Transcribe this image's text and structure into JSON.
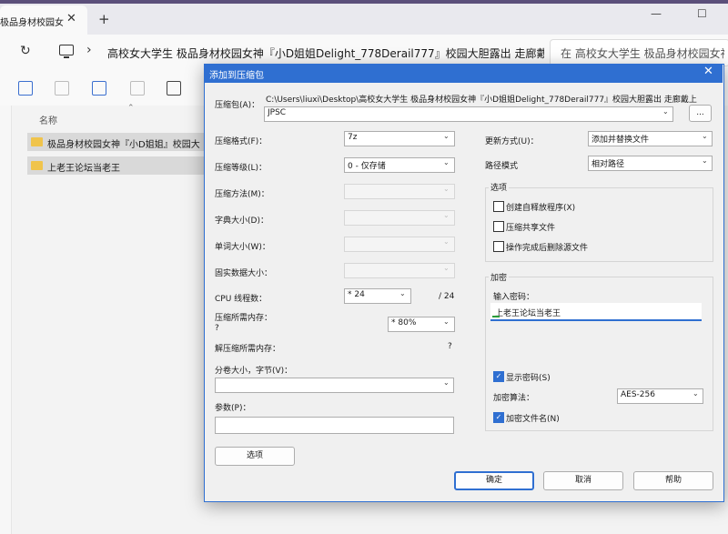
{
  "browser": {
    "tab_title": "极品身材校园女神",
    "tab_close": "✕",
    "new_tab": "+",
    "window_controls": [
      "—",
      "☐"
    ],
    "refresh_icon": "↻",
    "chevron": "›",
    "address_path": "高校女大学生 极品身材校园女神『小D姐姐Delight_778Derail777』校园大胆露出 走廊戴",
    "search_text": "在 高校女大学生 极品身材校园女神"
  },
  "explorer": {
    "column_name": "名称",
    "sort_arrow": "⌃",
    "rows": [
      {
        "label": "极品身材校园女神『小D姐姐』校园大"
      },
      {
        "label": "上老王论坛当老王"
      }
    ]
  },
  "dialog": {
    "title": "添加到压缩包",
    "close_icon": "✕",
    "archive_label": "压缩包(A)：",
    "archive_path": "C:\\Users\\liuxi\\Desktop\\高校女大学生 极品身材校园女神『小D姐姐Delight_778Derail777』校园大胆露出 走廊戴上",
    "archive_name": "JPSC",
    "browse_label": "...",
    "format_label": "压缩格式(F)：",
    "format_value": "7z",
    "level_label": "压缩等级(L)：",
    "level_value": "0 - 仅存储",
    "method_label": "压缩方法(M)：",
    "dict_label": "字典大小(D)：",
    "word_label": "单词大小(W)：",
    "solid_label": "固实数据大小：",
    "cpu_label": "CPU 线程数：",
    "cpu_value": "* 24",
    "cpu_total": "/ 24",
    "mem_compress_label": "压缩所需内存：",
    "mem_compress_q": "?",
    "mem_value": "* 80%",
    "mem_decompress_label": "解压缩所需内存：",
    "mem_decompress_q": "?",
    "volume_label": "分卷大小，字节(V)：",
    "params_label": "参数(P)：",
    "options_button": "选项",
    "update_label": "更新方式(U)：",
    "update_value": "添加并替换文件",
    "pathmode_label": "路径模式",
    "pathmode_value": "相对路径",
    "options_group": "选项",
    "opt_sfx": "创建自释放程序(X)",
    "opt_shared": "压缩共享文件",
    "opt_delete": "操作完成后删除源文件",
    "encrypt_group": "加密",
    "password_label": "输入密码：",
    "password_value": "上老王论坛当老王",
    "show_password": "显示密码(S)",
    "enc_method_label": "加密算法：",
    "enc_method_value": "AES-256",
    "encrypt_names": "加密文件名(N)",
    "ok": "确定",
    "cancel": "取消",
    "help": "帮助",
    "dropdown_icon": "⌄",
    "check_mark": "✓"
  }
}
